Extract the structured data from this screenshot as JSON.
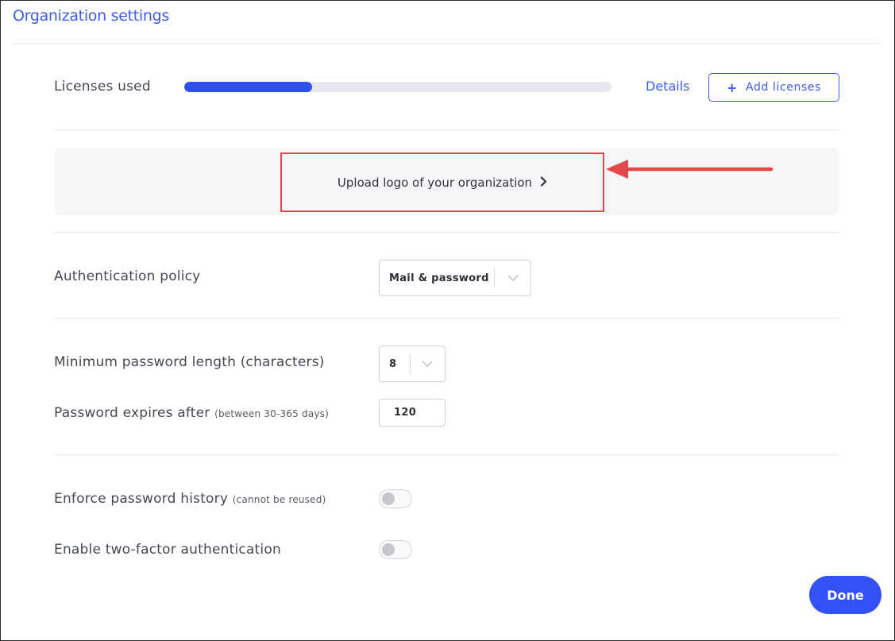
{
  "dialog": {
    "title": "Organization settings"
  },
  "licenses": {
    "label": "Licenses used",
    "used_fraction": 0.3,
    "details_link": "Details",
    "add_button": {
      "icon": "plus-icon",
      "label": "Add licenses"
    }
  },
  "logo_upload": {
    "label": "Upload logo of your organization",
    "icon": "chevron-right-icon",
    "highlight_color": "#e3474a"
  },
  "authentication": {
    "label": "Authentication policy",
    "selected": "Mail & password",
    "icon": "chevron-down-icon"
  },
  "password": {
    "min_length_label": "Minimum password length (characters)",
    "min_length_value": "8",
    "expires_label": "Password expires after",
    "expires_hint": "(between 30-365 days)",
    "expires_value": "120"
  },
  "history": {
    "label": "Enforce password history",
    "hint": "(cannot be reused)",
    "enabled": false
  },
  "two_factor": {
    "label": "Enable two-factor authentication",
    "enabled": false
  },
  "footer": {
    "done_label": "Done"
  },
  "colors": {
    "accent": "#3d5bf0",
    "progress_fill": "#2f4ff0",
    "primary_button": "#3352f5",
    "annotation_red": "#e3474a"
  }
}
